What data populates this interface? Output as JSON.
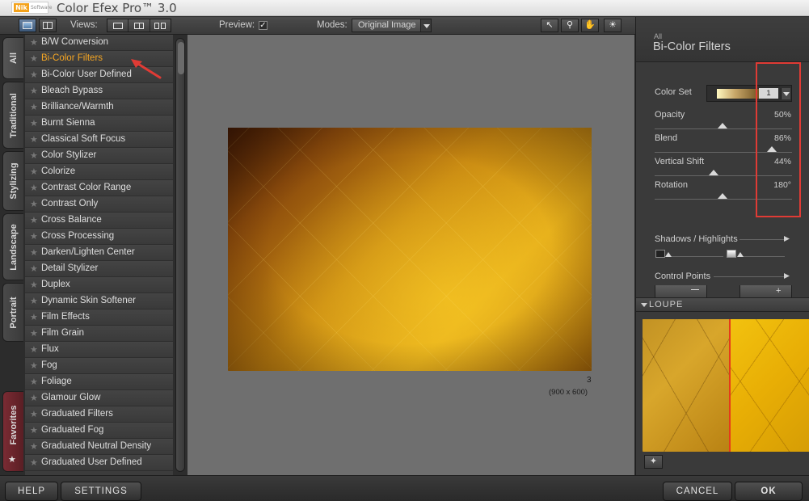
{
  "window": {
    "title": "Color Efex Pro™ 3.0",
    "brand": "Nik",
    "brand_sub": "Software"
  },
  "toolbar": {
    "views_label": "Views:",
    "preview_label": "Preview:",
    "preview_checked": "✓",
    "modes_label": "Modes:",
    "modes_value": "Original Image",
    "tools": [
      "pointer-tool",
      "zoom-tool",
      "hand-tool",
      "loupe-tool"
    ]
  },
  "tabs": [
    "All",
    "Traditional",
    "Stylizing",
    "Landscape",
    "Portrait",
    "Favorites"
  ],
  "filters": [
    "B/W Conversion",
    "Bi-Color Filters",
    "Bi-Color User Defined",
    "Bleach Bypass",
    "Brilliance/Warmth",
    "Burnt Sienna",
    "Classical Soft Focus",
    "Color Stylizer",
    "Colorize",
    "Contrast Color Range",
    "Contrast Only",
    "Cross Balance",
    "Cross Processing",
    "Darken/Lighten Center",
    "Detail Stylizer",
    "Duplex",
    "Dynamic Skin Softener",
    "Film Effects",
    "Film Grain",
    "Flux",
    "Fog",
    "Foliage",
    "Glamour Glow",
    "Graduated Filters",
    "Graduated Fog",
    "Graduated Neutral Density",
    "Graduated User Defined"
  ],
  "selected_filter": "Bi-Color Filters",
  "image": {
    "number": "3",
    "dimensions": "(900 x 600)"
  },
  "panel": {
    "category": "All",
    "title": "Bi-Color Filters",
    "color_set_label": "Color Set",
    "color_set_value": "1",
    "params": [
      {
        "label": "Opacity",
        "value": "50%",
        "level": 0.5
      },
      {
        "label": "Blend",
        "value": "86%",
        "level": 0.86
      },
      {
        "label": "Vertical Shift",
        "value": "44%",
        "level": 0.44
      },
      {
        "label": "Rotation",
        "value": "180°",
        "level": 0.5
      }
    ],
    "shadows_highlights": "Shadows / Highlights",
    "control_points": "Control Points",
    "loupe": "LOUPE"
  },
  "buttons": {
    "help": "HELP",
    "settings": "SETTINGS",
    "cancel": "CANCEL",
    "ok": "OK"
  },
  "colors": {
    "accent_selected": "#f5a623",
    "annotation_red": "#e03b35"
  }
}
